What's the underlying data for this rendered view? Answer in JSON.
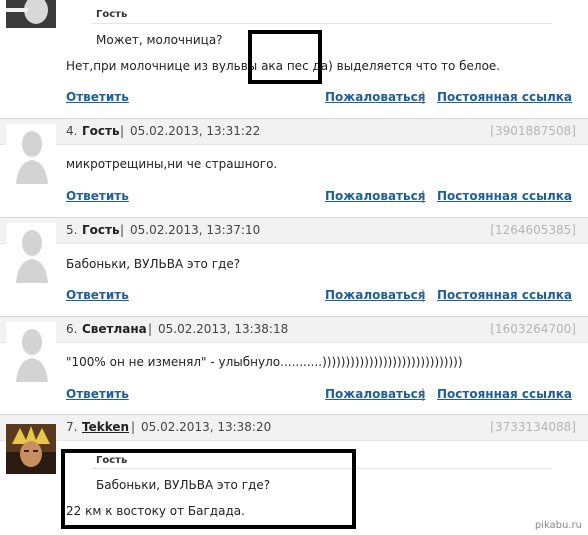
{
  "top": {
    "quote_author": "Гость",
    "quote_text": "Может, молочница?",
    "reply_text": "Нет,при молочнице из вульвы ака пес да) выделяется что то белое.",
    "reply_label": "Ответить",
    "report_label": "Пожаловаться",
    "separator": "|",
    "permalink_label": "Постоянная ссылка"
  },
  "comments": [
    {
      "num": "4.",
      "author": "Гость",
      "bar": "|",
      "date": "05.02.2013, 13:31:22",
      "id": "[3901887508]",
      "text": "микротрещины,ни че страшного.",
      "reply_label": "Ответить",
      "report_label": "Пожаловаться",
      "separator": "|",
      "permalink_label": "Постоянная ссылка"
    },
    {
      "num": "5.",
      "author": "Гость",
      "bar": "|",
      "date": "05.02.2013, 13:37:10",
      "id": "[1264605385]",
      "text": "Бабоньки, ВУЛЬВА это где?",
      "reply_label": "Ответить",
      "report_label": "Пожаловаться",
      "separator": "|",
      "permalink_label": "Постоянная ссылка"
    },
    {
      "num": "6.",
      "author": "Светлана",
      "bar": "|",
      "date": "05.02.2013, 13:38:18",
      "id": "[1603264700]",
      "text": "\"100% он не изменял\" - улыбнуло...........))))))))))))))))))))))))))))))",
      "reply_label": "Ответить",
      "report_label": "Пожаловаться",
      "separator": "|",
      "permalink_label": "Постоянная ссылка"
    },
    {
      "num": "7.",
      "author": "Tekken",
      "bar": "|",
      "date": "05.02.2013, 13:38:20",
      "id": "[3733134088]",
      "quote_author": "Гость",
      "quote_text": "Бабоньки, ВУЛЬВА это где?",
      "text": "22 км к востоку от Багдада."
    }
  ],
  "watermark": "pikabu.ru",
  "colors": {
    "link": "#1f5f99",
    "header_bg": "#f2f2f2",
    "id_gray": "#b5b5b5",
    "highlight_box": "#000000"
  }
}
